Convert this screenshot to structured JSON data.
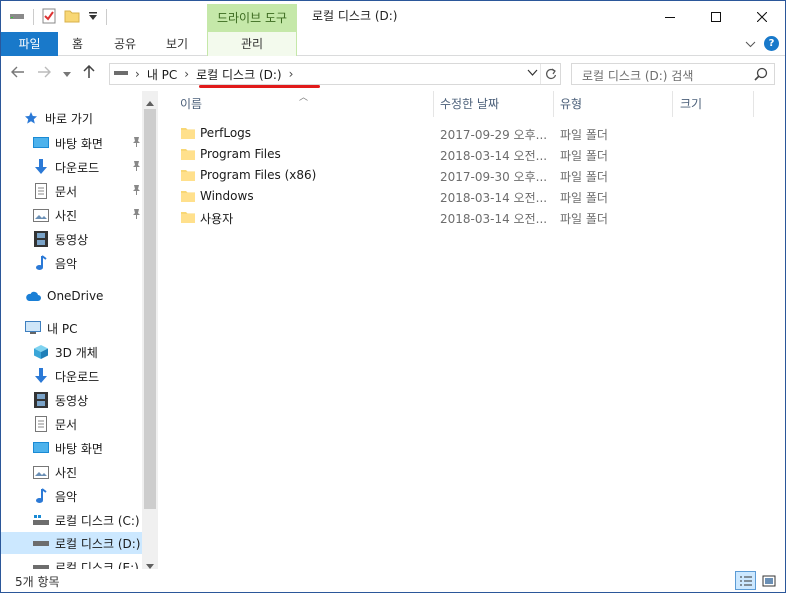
{
  "window": {
    "title": "로컬 디스크 (D:)"
  },
  "ribbon": {
    "context_group": "드라이브 도구",
    "tabs": {
      "file": "파일",
      "home": "홈",
      "share": "공유",
      "view": "보기",
      "manage": "관리"
    }
  },
  "address": {
    "crumbs": [
      "내 PC",
      "로컬 디스크 (D:)"
    ],
    "search_placeholder": "로컬 디스크 (D:) 검색"
  },
  "nav": {
    "quick_access": "바로 가기",
    "quick_items": [
      "바탕 화면",
      "다운로드",
      "문서",
      "사진",
      "동영상",
      "음악"
    ],
    "onedrive": "OneDrive",
    "this_pc": "내 PC",
    "pc_items": [
      "3D 개체",
      "다운로드",
      "동영상",
      "문서",
      "바탕 화면",
      "사진",
      "음악",
      "로컬 디스크 (C:)",
      "로컬 디스크 (D:)",
      "로컬 디스크 (E:)"
    ]
  },
  "columns": {
    "name": "이름",
    "date": "수정한 날짜",
    "type": "유형",
    "size": "크기"
  },
  "files": [
    {
      "name": "PerfLogs",
      "date": "2017-09-29 오후...",
      "type": "파일 폴더"
    },
    {
      "name": "Program Files",
      "date": "2018-03-14 오전...",
      "type": "파일 폴더"
    },
    {
      "name": "Program Files (x86)",
      "date": "2017-09-30 오후...",
      "type": "파일 폴더"
    },
    {
      "name": "Windows",
      "date": "2018-03-14 오전...",
      "type": "파일 폴더"
    },
    {
      "name": "사용자",
      "date": "2018-03-14 오전...",
      "type": "파일 폴더"
    }
  ],
  "status": {
    "item_count": "5개 항목"
  },
  "colors": {
    "accent": "#1979ca",
    "context_tab": "#c5e8a9",
    "selection": "#cce8ff",
    "highlight": "#e11a1a",
    "folder": "#f8d775"
  }
}
